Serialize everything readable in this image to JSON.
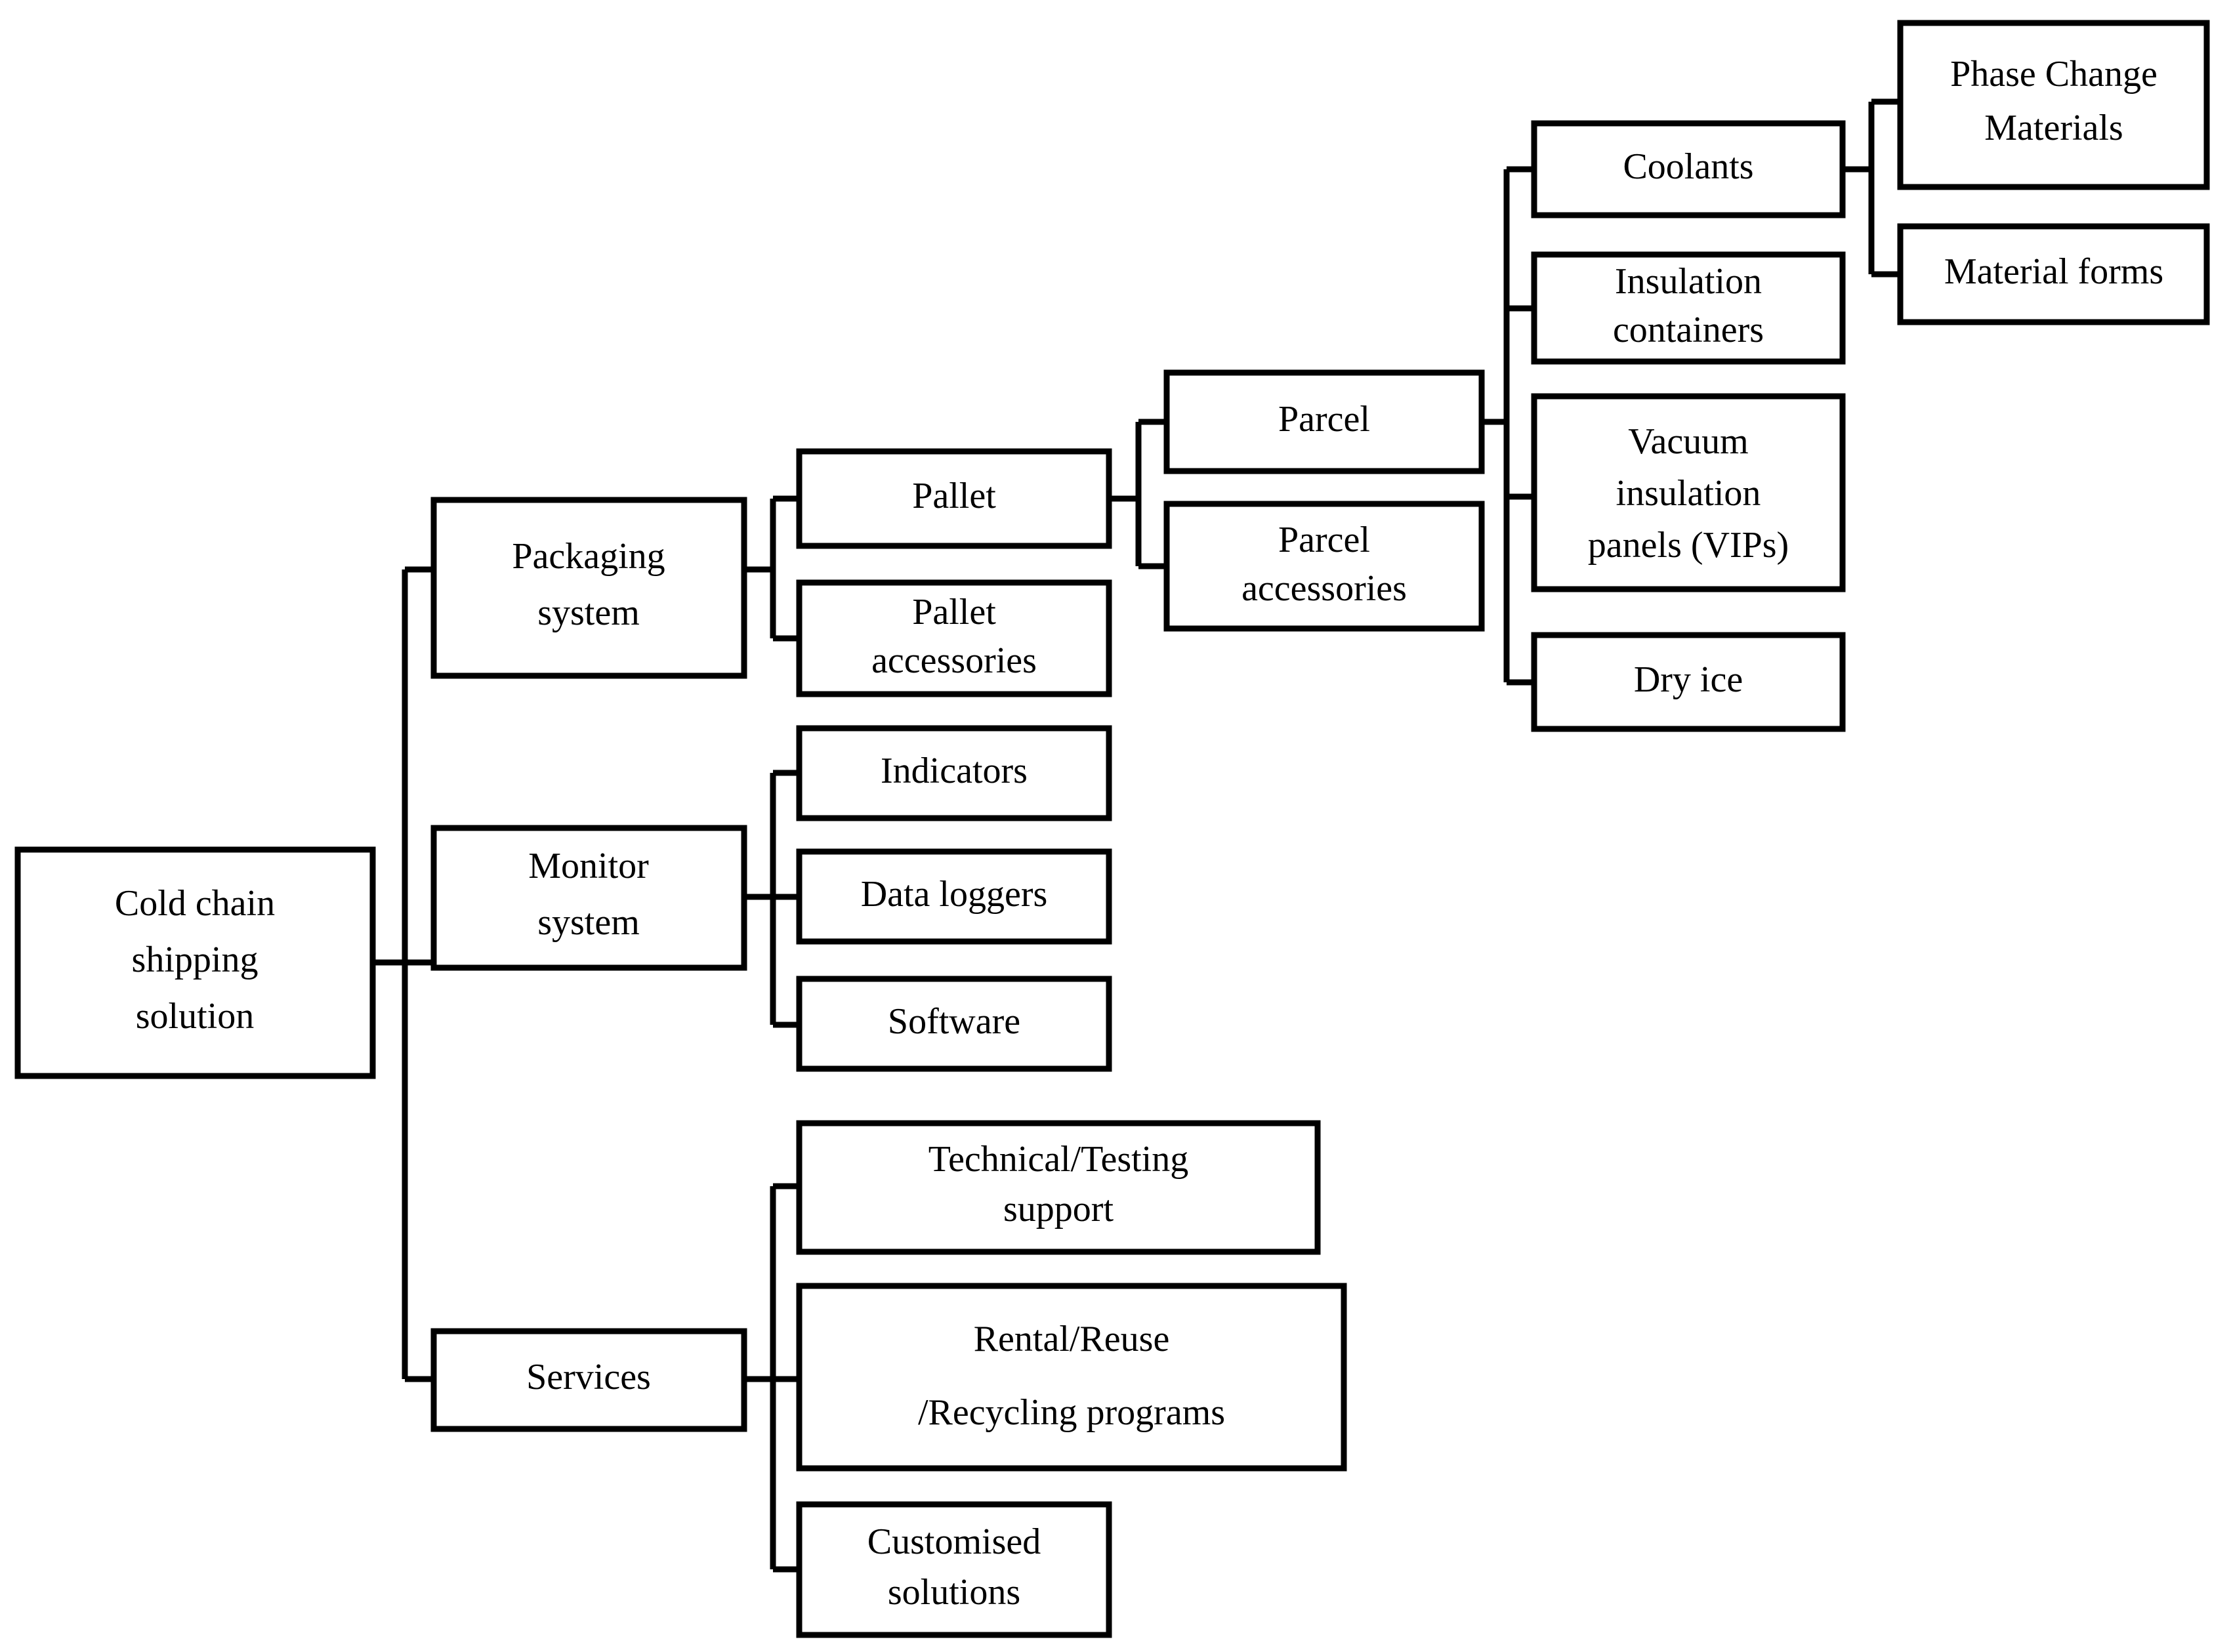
{
  "diagram": {
    "title": "Cold chain shipping solution breakdown",
    "type": "hierarchy-tree",
    "orientation": "left-to-right",
    "colors": {
      "background": "#ffffff",
      "box_fill": "#ffffff",
      "box_stroke": "#000000",
      "connector": "#000000",
      "text": "#000000"
    },
    "nodes": {
      "root": {
        "label": "Cold chain\nshipping\nsolution",
        "lines": [
          "Cold chain",
          "shipping",
          "solution"
        ]
      },
      "packaging_system": {
        "label": "Packaging system",
        "lines": [
          "Packaging",
          "system"
        ]
      },
      "monitor_system": {
        "label": "Monitor system",
        "lines": [
          "Monitor",
          "system"
        ]
      },
      "services": {
        "label": "Services",
        "lines": [
          "Services"
        ]
      },
      "pallet": {
        "label": "Pallet",
        "lines": [
          "Pallet"
        ]
      },
      "pallet_accessories": {
        "label": "Pallet accessories",
        "lines": [
          "Pallet",
          "accessories"
        ]
      },
      "parcel": {
        "label": "Parcel",
        "lines": [
          "Parcel"
        ]
      },
      "parcel_accessories": {
        "label": "Parcel accessories",
        "lines": [
          "Parcel",
          "accessories"
        ]
      },
      "coolants": {
        "label": "Coolants",
        "lines": [
          "Coolants"
        ]
      },
      "insulation_containers": {
        "label": "Insulation containers",
        "lines": [
          "Insulation",
          "containers"
        ]
      },
      "vacuum_insulation_panels": {
        "label": "Vacuum insulation panels (VIPs)",
        "lines": [
          "Vacuum",
          "insulation",
          "panels (VIPs)"
        ]
      },
      "dry_ice": {
        "label": "Dry ice",
        "lines": [
          "Dry ice"
        ]
      },
      "phase_change_materials": {
        "label": "Phase Change Materials",
        "lines": [
          "Phase Change",
          "Materials"
        ]
      },
      "material_forms": {
        "label": "Material forms",
        "lines": [
          "Material forms"
        ]
      },
      "indicators": {
        "label": "Indicators",
        "lines": [
          "Indicators"
        ]
      },
      "data_loggers": {
        "label": "Data loggers",
        "lines": [
          "Data loggers"
        ]
      },
      "software": {
        "label": "Software",
        "lines": [
          "Software"
        ]
      },
      "technical_testing_support": {
        "label": "Technical/Testing support",
        "lines": [
          "Technical/Testing",
          "support"
        ]
      },
      "rental_reuse_recycling_programs": {
        "label": "Rental/Reuse /Recycling programs",
        "lines": [
          "Rental/Reuse",
          "/Recycling programs"
        ]
      },
      "customised_solutions": {
        "label": "Customised solutions",
        "lines": [
          "Customised",
          "solutions"
        ]
      }
    },
    "edges": [
      {
        "from": "root",
        "to": "packaging_system"
      },
      {
        "from": "root",
        "to": "monitor_system"
      },
      {
        "from": "root",
        "to": "services"
      },
      {
        "from": "packaging_system",
        "to": "pallet"
      },
      {
        "from": "packaging_system",
        "to": "pallet_accessories"
      },
      {
        "from": "pallet",
        "to": "parcel"
      },
      {
        "from": "pallet",
        "to": "parcel_accessories"
      },
      {
        "from": "parcel",
        "to": "coolants"
      },
      {
        "from": "parcel",
        "to": "insulation_containers"
      },
      {
        "from": "parcel",
        "to": "vacuum_insulation_panels"
      },
      {
        "from": "parcel",
        "to": "dry_ice"
      },
      {
        "from": "coolants",
        "to": "phase_change_materials"
      },
      {
        "from": "coolants",
        "to": "material_forms"
      },
      {
        "from": "monitor_system",
        "to": "indicators"
      },
      {
        "from": "monitor_system",
        "to": "data_loggers"
      },
      {
        "from": "monitor_system",
        "to": "software"
      },
      {
        "from": "services",
        "to": "technical_testing_support"
      },
      {
        "from": "services",
        "to": "rental_reuse_recycling_programs"
      },
      {
        "from": "services",
        "to": "customised_solutions"
      }
    ]
  }
}
